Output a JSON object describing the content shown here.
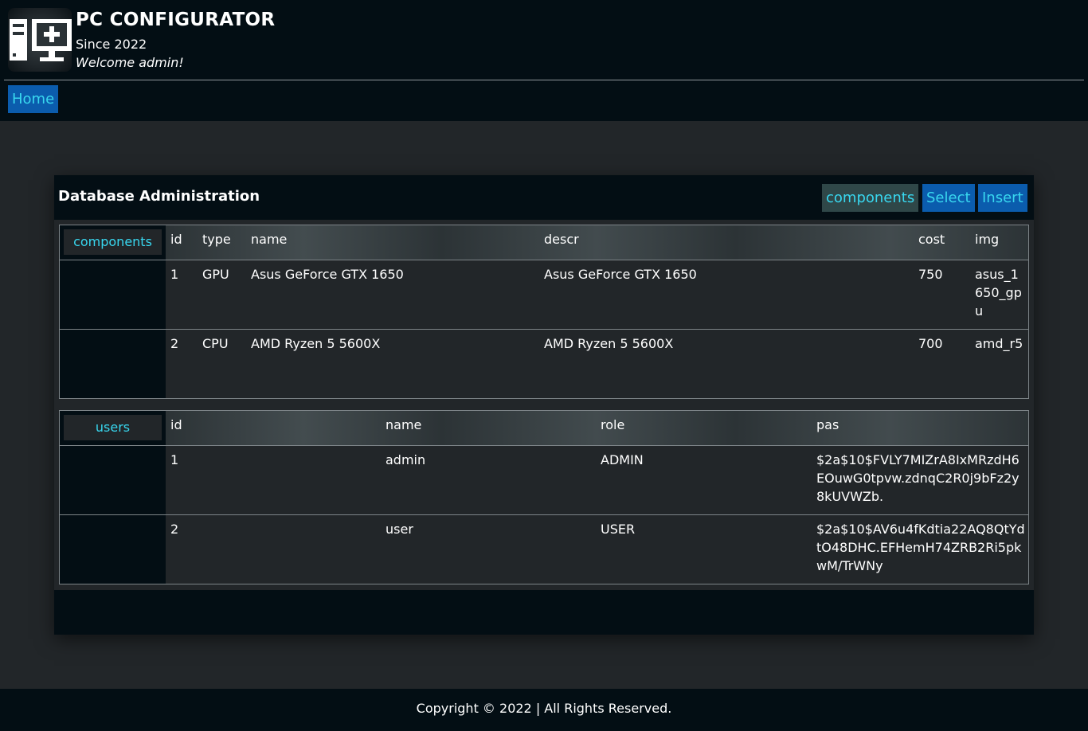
{
  "header": {
    "logo_icon": "pc-tower-monitor-icon",
    "title": "PC CONFIGURATOR",
    "since": "Since 2022",
    "welcome": "Welcome admin!"
  },
  "nav": {
    "home_label": "Home"
  },
  "admin": {
    "title": "Database Administration",
    "table_selector_value": "components",
    "select_label": "Select",
    "insert_label": "Insert"
  },
  "tables": {
    "components": {
      "label": "components",
      "columns": [
        "id",
        "type",
        "name",
        "descr",
        "cost",
        "img"
      ],
      "rows": [
        [
          "1",
          "GPU",
          "Asus GeForce GTX 1650",
          "Asus GeForce GTX 1650",
          "750",
          "asus_1650_gpu"
        ],
        [
          "2",
          "CPU",
          "AMD Ryzen 5 5600X",
          "AMD Ryzen 5 5600X",
          "700",
          "amd_r5"
        ]
      ]
    },
    "users": {
      "label": "users",
      "columns": [
        "id",
        "name",
        "role",
        "pas"
      ],
      "rows": [
        [
          "1",
          "admin",
          "ADMIN",
          "$2a$10$FVLY7MIZrA8IxMRzdH6EOuwG0tpvw.zdnqC2R0j9bFz2y8kUVWZb."
        ],
        [
          "2",
          "user",
          "USER",
          "$2a$10$AV6u4fKdtia22AQ8QtYdtO48DHC.EFHemH74ZRB2Ri5pkwM/TrWNy"
        ]
      ]
    }
  },
  "footer": {
    "copyright": "Copyright © 2022 | All Rights Reserved."
  },
  "colors": {
    "page_bg": "#222629",
    "bar_bg": "#030e14",
    "button_bg": "#0b5cad",
    "link_text": "#38d7ef"
  }
}
